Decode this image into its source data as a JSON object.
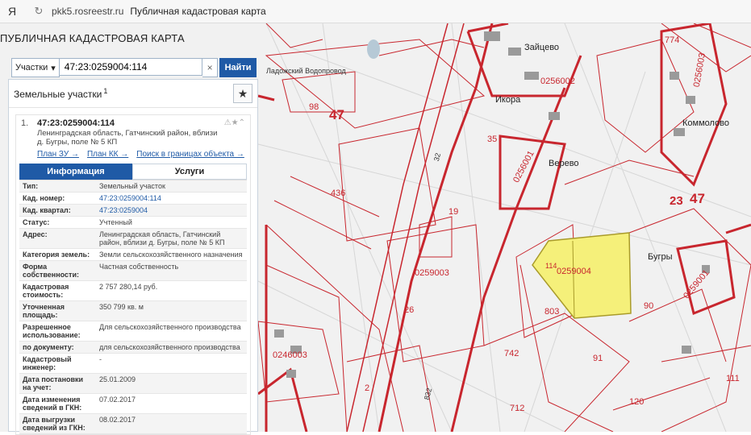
{
  "browser": {
    "logo": "Я",
    "reload": "↻",
    "url": "pkk5.rosreestr.ru",
    "tab_title": "Публичная кадастровая карта"
  },
  "app": {
    "title": "ПУБЛИЧНАЯ КАДАСТРОВАЯ КАРТА"
  },
  "search": {
    "type_label": "Участки",
    "type_caret": "▾",
    "value": "47:23:0259004:114",
    "clear": "×",
    "button": "Найти"
  },
  "panel": {
    "title": "Земельные участки",
    "count": "1",
    "star": "★",
    "result": {
      "num": "1.",
      "id": "47:23:0259004:114",
      "address": "Ленинградская область, Гатчинский район, вблизи д. Бугры, поле № 5 КП",
      "icons": "⚠★⌃",
      "links": [
        "План ЗУ →",
        "План КК →",
        "Поиск в границах объекта →"
      ]
    },
    "tabs": [
      "Информация",
      "Услуги"
    ],
    "rows": [
      {
        "k": "Тип:",
        "v": "Земельный участок"
      },
      {
        "k": "Кад. номер:",
        "v": "47:23:0259004:114"
      },
      {
        "k": "Кад. квартал:",
        "v": "47:23:0259004"
      },
      {
        "k": "Статус:",
        "v": "Учтенный"
      },
      {
        "k": "Адрес:",
        "v": "Ленинградская область, Гатчинский район, вблизи д. Бугры, поле № 5 КП"
      },
      {
        "k": "Категория земель:",
        "v": "Земли сельскохозяйственного назначения"
      },
      {
        "k": "Форма собственности:",
        "v": "Частная собственность"
      },
      {
        "k": "Кадастровая стоимость:",
        "v": "2 757 280,14 руб."
      },
      {
        "k": "Уточненная площадь:",
        "v": "350 799 кв. м"
      },
      {
        "k": "Разрешенное использование:",
        "v": "Для сельскохозяйственного производства"
      },
      {
        "k": "по документу:",
        "v": "для сельскохозяйственного производства"
      },
      {
        "k": "Кадастровый инженер:",
        "v": "-"
      },
      {
        "k": "Дата постановки на учет:",
        "v": "25.01.2009"
      },
      {
        "k": "Дата изменения сведений в ГКН:",
        "v": "07.02.2017"
      },
      {
        "k": "Дата выгрузки сведений из ГКН:",
        "v": "08.02.2017"
      }
    ]
  },
  "map": {
    "labels": {
      "l47a": "47",
      "l47b": "47",
      "l23": "23",
      "zaytsevo": "Зайцево",
      "ikora": "Икора",
      "verevo": "Верево",
      "kommolovo": "Коммолово",
      "bugry": "Бугры",
      "vodoprovod": "Ладожский Водопровод",
      "q0259003": "0259003",
      "q0259004": "0259004",
      "q0246003": "0246003",
      "q025902": "0256002",
      "q025901": "0256001",
      "q0259001": "0259001",
      "q0256003": "0256003",
      "n114": "114",
      "n98": "98",
      "n35": "35",
      "n19": "19",
      "n436": "436",
      "n26": "26",
      "n803": "803",
      "n742": "742",
      "n91": "91",
      "n90": "90",
      "n712": "712",
      "n120": "120",
      "n111": "111",
      "n774": "774",
      "n2": "2",
      "n32": "32",
      "n832": "832"
    },
    "colors": {
      "boundary": "#c8262e",
      "selected": "#f5f07a",
      "background": "#f1f1f1"
    }
  }
}
